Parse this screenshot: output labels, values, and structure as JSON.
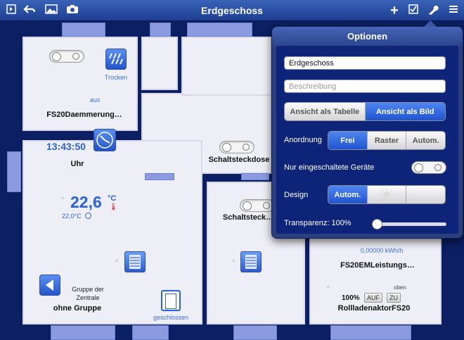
{
  "header": {
    "title": "Erdgeschoss"
  },
  "toolbar": {
    "left_icons": [
      "sidebar-toggle-icon",
      "back-arrow-icon",
      "image-icon",
      "camera-icon"
    ],
    "right_icons": [
      "plus-icon",
      "checkbox-icon",
      "wrench-icon",
      "menu-icon"
    ]
  },
  "devices": {
    "daemmerung": {
      "status": "aus",
      "name": "FS20Daemmerung…",
      "icon_label": "Trocken"
    },
    "clock": {
      "time": "13:43:50",
      "name": "Uhr"
    },
    "thermo": {
      "temp": "22,6",
      "unit": "°C",
      "set_temp": "22,0°C"
    },
    "group": {
      "line1": "Gruppe der",
      "line2": "Zentrale",
      "name": "ohne Gruppe"
    },
    "door": {
      "status": "geschlossen"
    },
    "steckdose1": {
      "name": "Schaltsteckdose"
    },
    "steckdose2": {
      "name": "Schaltsteck…"
    },
    "leistung": {
      "value": "0,00000 kWh/h",
      "name": "FS20EMLeistungs…"
    },
    "rollladen": {
      "position": "oben",
      "percent": "100%",
      "up": "AUF",
      "down": "ZU",
      "name": "RollladenaktorFS20"
    }
  },
  "options": {
    "title": "Optionen",
    "name_value": "Erdgeschoss",
    "description_placeholder": "Beschreibung",
    "view_mode": {
      "options": [
        "Ansicht als Tabelle",
        "Ansicht als Bild"
      ],
      "selected": "Ansicht als Bild"
    },
    "arrangement": {
      "label": "Anordnung",
      "options": [
        "Frei",
        "Raster",
        "Autom."
      ],
      "selected": "Frei"
    },
    "only_on": {
      "label": "Nur eingeschaltete Geräte",
      "value": false
    },
    "design": {
      "label": "Design",
      "options": [
        "Autom.",
        "sun-icon",
        "moon-icon"
      ],
      "selected": "Autom."
    },
    "transparency": {
      "label": "Transparenz: 100%",
      "value": 0.0
    }
  },
  "colors": {
    "accent": "#2a62d8",
    "bar": "#2a4fa6",
    "plan": "#0c1f63"
  }
}
